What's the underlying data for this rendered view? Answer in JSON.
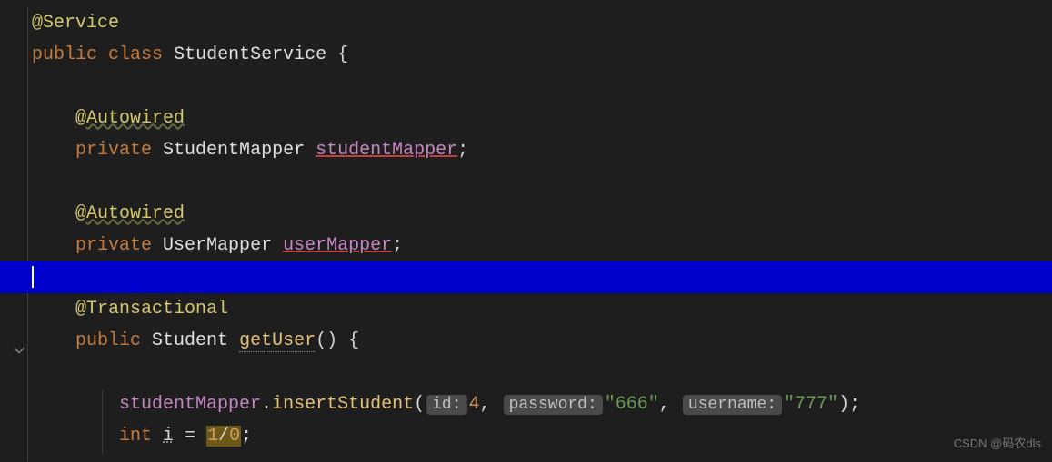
{
  "code": {
    "line1_annotation": "@Service",
    "line2_keyword1": "public",
    "line2_keyword2": "class",
    "line2_class": "StudentService",
    "line2_brace": "{",
    "line4_annotation": "@Autowired",
    "line5_keyword": "private",
    "line5_type": "StudentMapper",
    "line5_field": "studentMapper",
    "line5_semi": ";",
    "line7_annotation": "@Autowired",
    "line8_keyword": "private",
    "line8_type": "UserMapper",
    "line8_field": "userMapper",
    "line8_semi": ";",
    "line10_annotation": "@Transactional",
    "line11_keyword": "public",
    "line11_type": "Student",
    "line11_method": "getUser",
    "line11_parens": "()",
    "line11_brace": "{",
    "line13_field": "studentMapper",
    "line13_dot": ".",
    "line13_method": "insertStudent",
    "line13_open": "(",
    "line13_hint1": "id:",
    "line13_val1": "4",
    "line13_comma1": ",",
    "line13_hint2": "password:",
    "line13_val2": "\"666\"",
    "line13_comma2": ",",
    "line13_hint3": "username:",
    "line13_val3": "\"777\"",
    "line13_close": ");",
    "line14_type": "int",
    "line14_var": "i",
    "line14_eq": "=",
    "line14_expr1": "1",
    "line14_slash": "/",
    "line14_expr2": "0",
    "line14_semi": ";"
  },
  "watermark": "CSDN @码农dls"
}
